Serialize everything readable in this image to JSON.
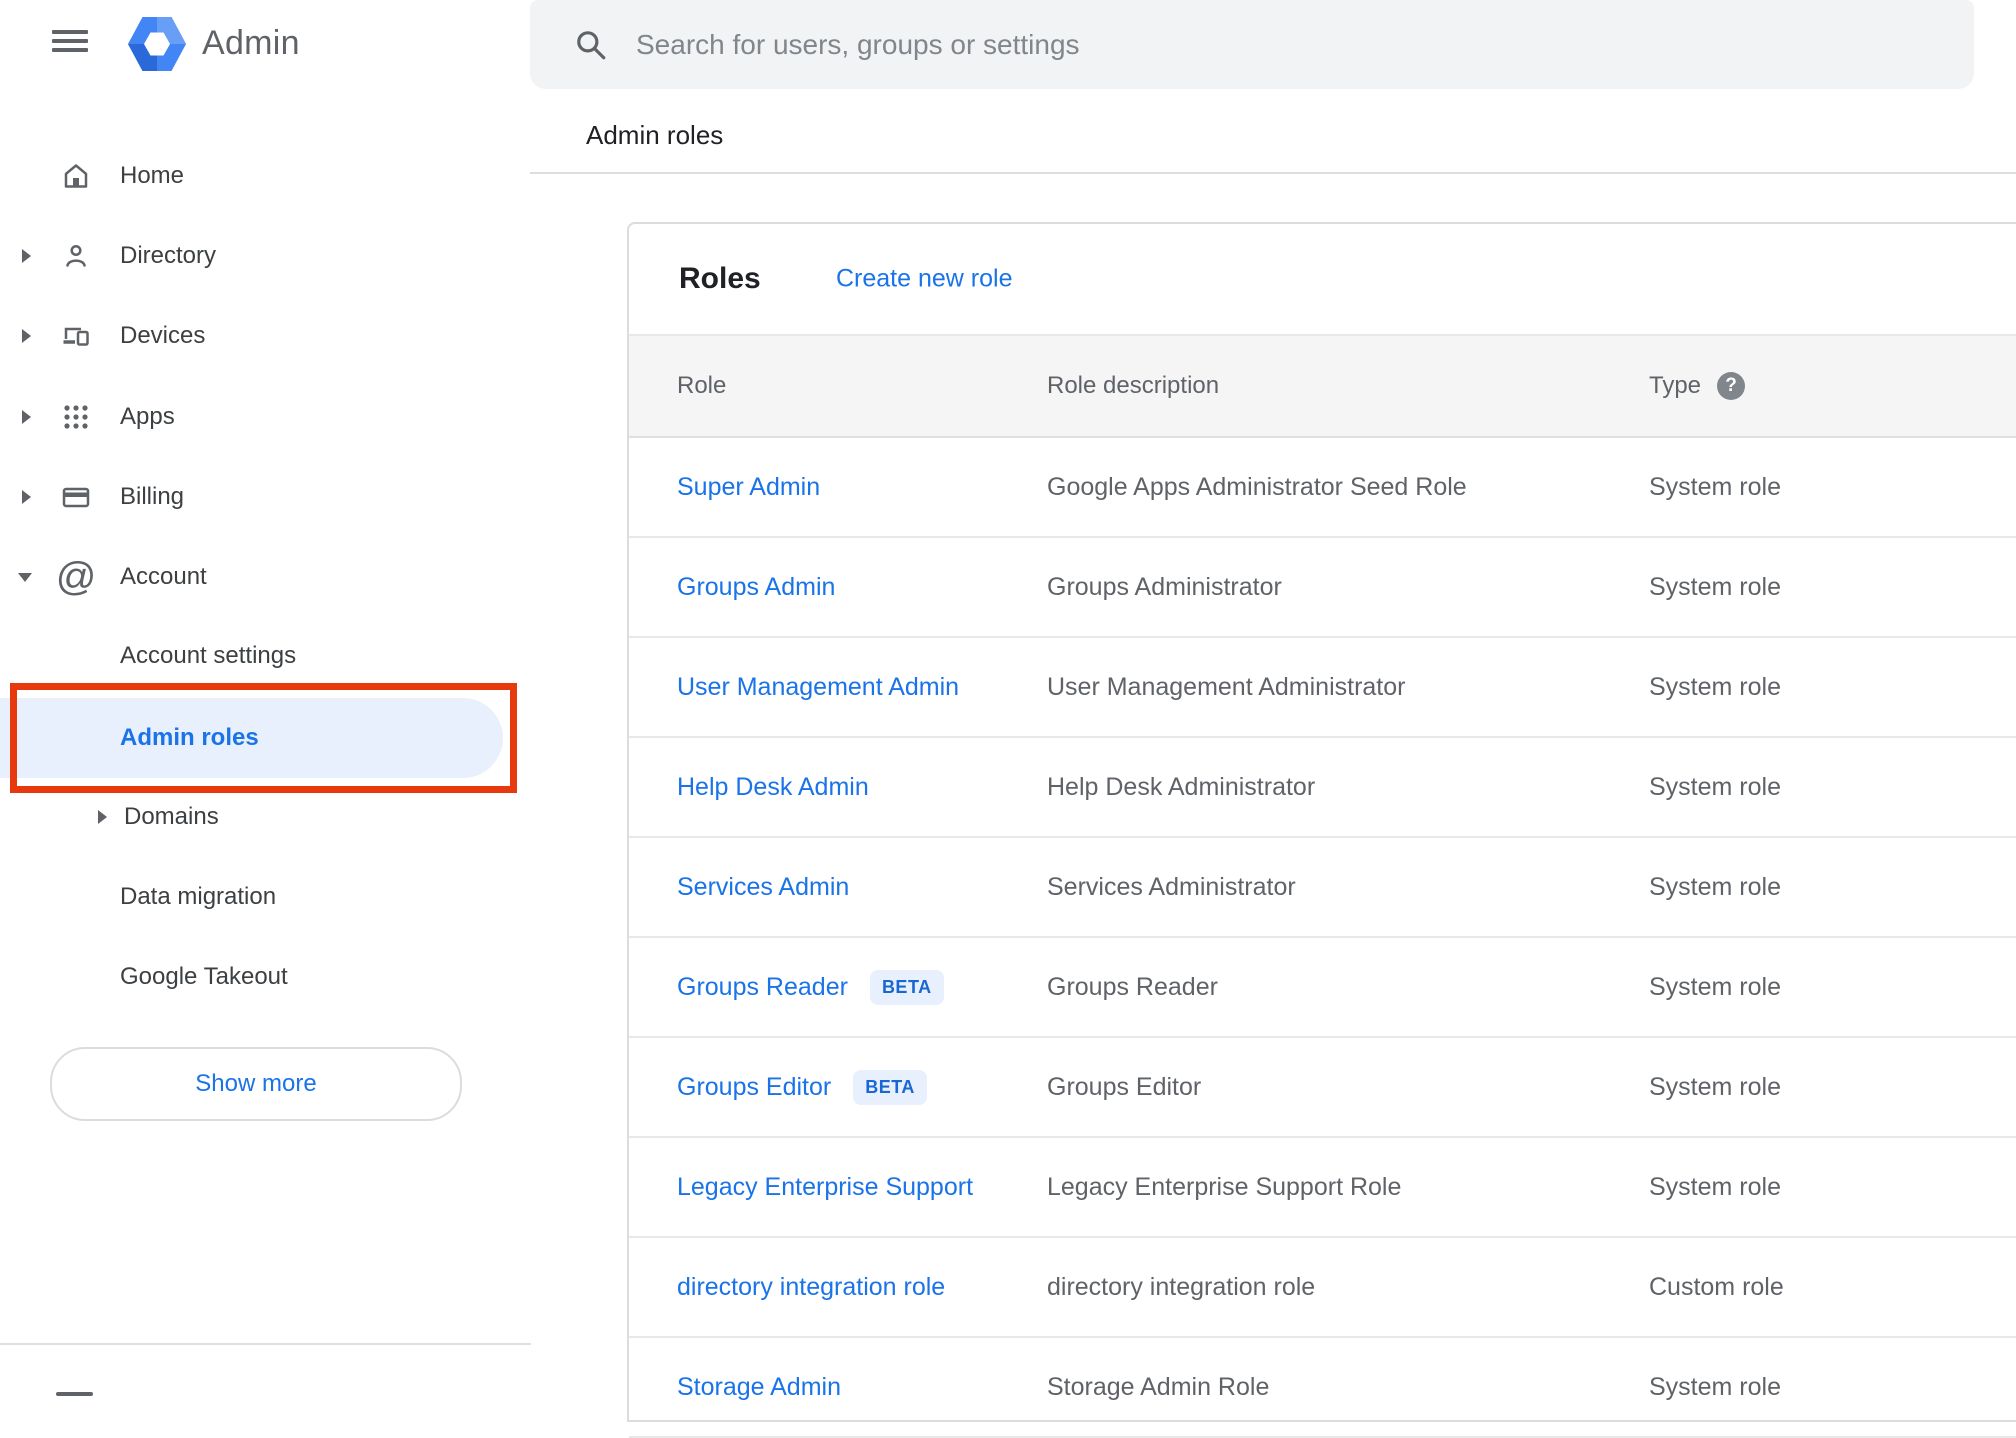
{
  "app": {
    "title": "Admin"
  },
  "search": {
    "placeholder": "Search for users, groups or settings"
  },
  "breadcrumb": "Admin roles",
  "sidebar": {
    "items": [
      {
        "label": "Home"
      },
      {
        "label": "Directory"
      },
      {
        "label": "Devices"
      },
      {
        "label": "Apps"
      },
      {
        "label": "Billing"
      },
      {
        "label": "Account"
      }
    ],
    "sub_items": [
      {
        "label": "Account settings"
      },
      {
        "label": "Admin roles"
      },
      {
        "label": "Domains"
      },
      {
        "label": "Data migration"
      },
      {
        "label": "Google Takeout"
      }
    ],
    "show_more_label": "Show more"
  },
  "roles": {
    "title": "Roles",
    "create_link": "Create new role",
    "columns": [
      "Role",
      "Role description",
      "Type"
    ],
    "rows": [
      {
        "name": "Super Admin",
        "description": "Google Apps Administrator Seed Role",
        "type": "System role"
      },
      {
        "name": "Groups Admin",
        "description": "Groups Administrator",
        "type": "System role"
      },
      {
        "name": "User Management Admin",
        "description": "User Management Administrator",
        "type": "System role"
      },
      {
        "name": "Help Desk Admin",
        "description": "Help Desk Administrator",
        "type": "System role"
      },
      {
        "name": "Services Admin",
        "description": "Services Administrator",
        "type": "System role"
      },
      {
        "name": "Groups Reader",
        "badge": "BETA",
        "description": "Groups Reader",
        "type": "System role"
      },
      {
        "name": "Groups Editor",
        "badge": "BETA",
        "description": "Groups Editor",
        "type": "System role"
      },
      {
        "name": "Legacy Enterprise Support",
        "description": "Legacy Enterprise Support Role",
        "type": "System role"
      },
      {
        "name": "directory integration role",
        "description": "directory integration role",
        "type": "Custom role"
      },
      {
        "name": "Storage Admin",
        "description": "Storage Admin Role",
        "type": "System role"
      }
    ]
  },
  "colors": {
    "accent": "#1a73e8",
    "annotation_red": "#e8380d",
    "badge_bg": "#e8f0fe",
    "badge_text": "#1967d2",
    "search_bg": "#f1f3f4"
  }
}
